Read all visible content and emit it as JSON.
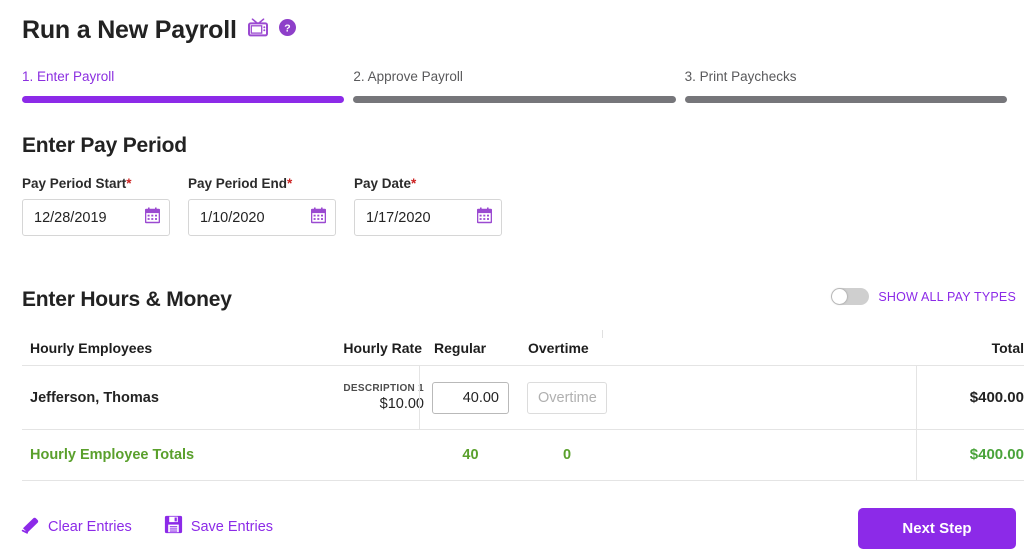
{
  "header": {
    "title": "Run a New Payroll",
    "video_icon": "tv-icon",
    "help_icon": "help-circle-icon"
  },
  "steps": [
    {
      "label": "1. Enter Payroll",
      "active": true
    },
    {
      "label": "2. Approve Payroll",
      "active": false
    },
    {
      "label": "3. Print Paychecks",
      "active": false
    }
  ],
  "pay_period": {
    "section_title": "Enter Pay Period",
    "fields": [
      {
        "label": "Pay Period Start",
        "required": "*",
        "value": "12/28/2019",
        "icon": "calendar-icon"
      },
      {
        "label": "Pay Period End",
        "required": "*",
        "value": "1/10/2020",
        "icon": "calendar-icon"
      },
      {
        "label": "Pay Date",
        "required": "*",
        "value": "1/17/2020",
        "icon": "calendar-icon"
      }
    ]
  },
  "hours_money": {
    "section_title": "Enter Hours & Money",
    "toggle": {
      "label": "SHOW ALL PAY TYPES",
      "state": "off"
    },
    "columns": {
      "employees": "Hourly Employees",
      "rate": "Hourly Rate",
      "regular": "Regular",
      "overtime": "Overtime",
      "total": "Total"
    },
    "rows": [
      {
        "name": "Jefferson, Thomas",
        "rate_description": "DESCRIPTION 1",
        "rate_amount": "$10.00",
        "regular_value": "40.00",
        "overtime_value": "",
        "overtime_placeholder": "Overtime",
        "total": "$400.00"
      }
    ],
    "totals": {
      "label": "Hourly Employee Totals",
      "regular": "40",
      "overtime": "0",
      "total": "$400.00"
    }
  },
  "footer": {
    "clear_label": "Clear Entries",
    "clear_icon": "eraser-icon",
    "save_label": "Save Entries",
    "save_icon": "floppy-disk-icon",
    "next_label": "Next Step"
  },
  "colors": {
    "accent_purple": "#8c2ae8",
    "step_inactive": "#76767a",
    "totals_green": "#5aa02c",
    "required_red": "#cc2222"
  }
}
